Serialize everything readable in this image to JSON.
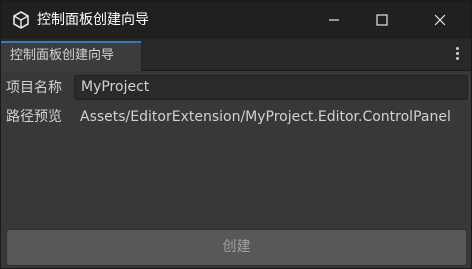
{
  "window": {
    "title": "控制面板创建向导",
    "icon": "unity-cube-icon"
  },
  "tab": {
    "label": "控制面板创建向导"
  },
  "form": {
    "name_label": "项目名称",
    "name_value": "MyProject",
    "preview_label": "路径预览",
    "preview_value": "Assets/EditorExtension/MyProject.Editor.ControlPanel"
  },
  "actions": {
    "create_label": "创建"
  },
  "colors": {
    "titlebar": "#202020",
    "background": "#383838",
    "tab_accent": "#3a79bb",
    "button": "#585858"
  }
}
